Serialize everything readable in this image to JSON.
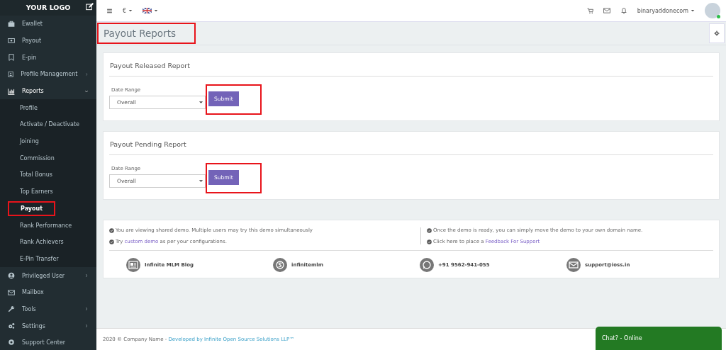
{
  "sidebar": {
    "logo": "YOUR LOGO",
    "items": [
      {
        "label": "Ewallet"
      },
      {
        "label": "Payout"
      },
      {
        "label": "E-pin"
      },
      {
        "label": "Profile Management",
        "expanded": false
      },
      {
        "label": "Reports",
        "expanded": true,
        "children": [
          {
            "label": "Profile",
            "selected": false,
            "highlighted": false
          },
          {
            "label": "Activate / Deactivate",
            "selected": false,
            "highlighted": false
          },
          {
            "label": "Joining",
            "selected": false,
            "highlighted": false
          },
          {
            "label": "Commission",
            "selected": false,
            "highlighted": false
          },
          {
            "label": "Total Bonus",
            "selected": false,
            "highlighted": false
          },
          {
            "label": "Top Earners",
            "selected": false,
            "highlighted": false
          },
          {
            "label": "Payout",
            "selected": true,
            "highlighted": true
          },
          {
            "label": "Rank Performance",
            "selected": false,
            "highlighted": false
          },
          {
            "label": "Rank Achievers",
            "selected": false,
            "highlighted": false
          },
          {
            "label": "E-Pin Transfer",
            "selected": false,
            "highlighted": false
          }
        ]
      },
      {
        "label": "Privileged User",
        "expanded": false
      },
      {
        "label": "Mailbox"
      },
      {
        "label": "Tools",
        "expanded": false
      },
      {
        "label": "Settings",
        "expanded": false
      },
      {
        "label": "Support Center"
      }
    ]
  },
  "topbar": {
    "currency": "€",
    "username": "binaryaddonecom",
    "online": true
  },
  "page": {
    "title": "Payout Reports",
    "highlighted": true
  },
  "panels": [
    {
      "title": "Payout Released Report",
      "field_label": "Date Range",
      "value": "Overall",
      "button": "Submit",
      "highlighted": true
    },
    {
      "title": "Payout Pending Report",
      "field_label": "Date Range",
      "value": "Overall",
      "button": "Submit",
      "highlighted": true
    }
  ],
  "info": {
    "notes_left": [
      {
        "text": "You are viewing shared demo. Multiple users may try this demo simultaneously"
      },
      {
        "before": "Try ",
        "link": "custom demo",
        "after": " as per your configurations."
      }
    ],
    "notes_right": [
      {
        "text": "Once the demo is ready, you can simply move the demo to your own domain name."
      },
      {
        "before": "Click here to place a ",
        "link": "Feedback For Support"
      }
    ],
    "contacts": [
      {
        "label": "Infinite MLM Blog"
      },
      {
        "label": "infinitemlm"
      },
      {
        "label": "+91 9562-941-055"
      },
      {
        "label": "support@ioss.in"
      }
    ]
  },
  "footer": {
    "text": "2020 © Company Name - ",
    "link": "Developed by Infinite Open Source Solutions LLP™"
  },
  "chat": {
    "label": "Chat? - Online"
  }
}
